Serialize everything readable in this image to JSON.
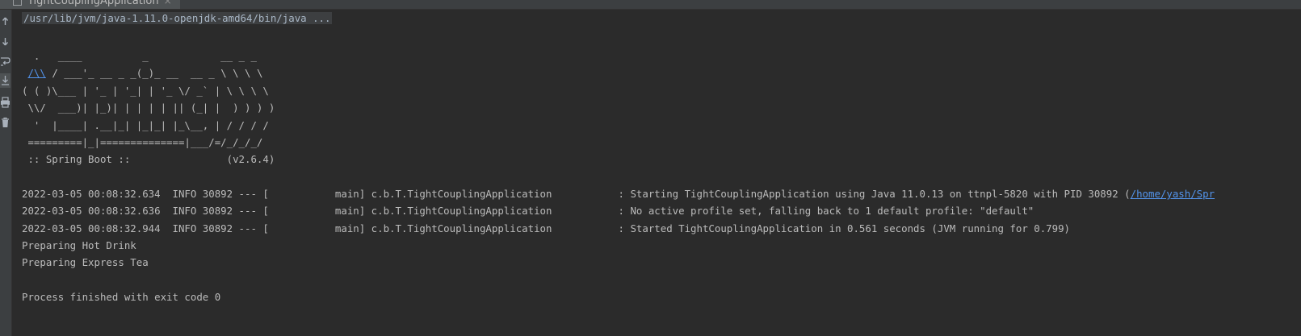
{
  "tab": {
    "title": "TightCouplingApplication"
  },
  "toolbar": {
    "tools": [
      "up-arrow-icon",
      "down-arrow-icon",
      "soft-wrap-icon",
      "scroll-to-end-icon",
      "print-icon",
      "trash-icon"
    ]
  },
  "console": {
    "command": "/usr/lib/jvm/java-1.11.0-openjdk-amd64/bin/java ...",
    "banner": [
      "  .   ____          _            __ _ _",
      " /\\\\ / ___'_ __ _ _(_)_ __  __ _ \\ \\ \\ \\",
      "( ( )\\___ | '_ | '_| | '_ \\/ _` | \\ \\ \\ \\",
      " \\\\/  ___)| |_)| | | | | || (_| |  ) ) ) )",
      "  '  |____| .__|_| |_|_| |_\\__, | / / / /",
      " =========|_|==============|___/=/_/_/_/",
      " :: Spring Boot ::                (v2.6.4)"
    ],
    "banner_link": "/\\\\",
    "banner_line2_rest": " / ___'_ __ _ _(_)_ __  __ _ \\ \\ \\ \\",
    "log": [
      "2022-03-05 00:08:32.634  INFO 30892 --- [           main] c.b.T.TightCouplingApplication           : Starting TightCouplingApplication using Java 11.0.13 on ttnpl-5820 with PID 30892 (",
      "2022-03-05 00:08:32.636  INFO 30892 --- [           main] c.b.T.TightCouplingApplication           : No active profile set, falling back to 1 default profile: \"default\"",
      "2022-03-05 00:08:32.944  INFO 30892 --- [           main] c.b.T.TightCouplingApplication           : Started TightCouplingApplication in 0.561 seconds (JVM running for 0.799)"
    ],
    "log_link": "/home/yash/Spr",
    "output": [
      "Preparing Hot Drink",
      "Preparing Express Tea"
    ],
    "exit": "Process finished with exit code 0"
  }
}
